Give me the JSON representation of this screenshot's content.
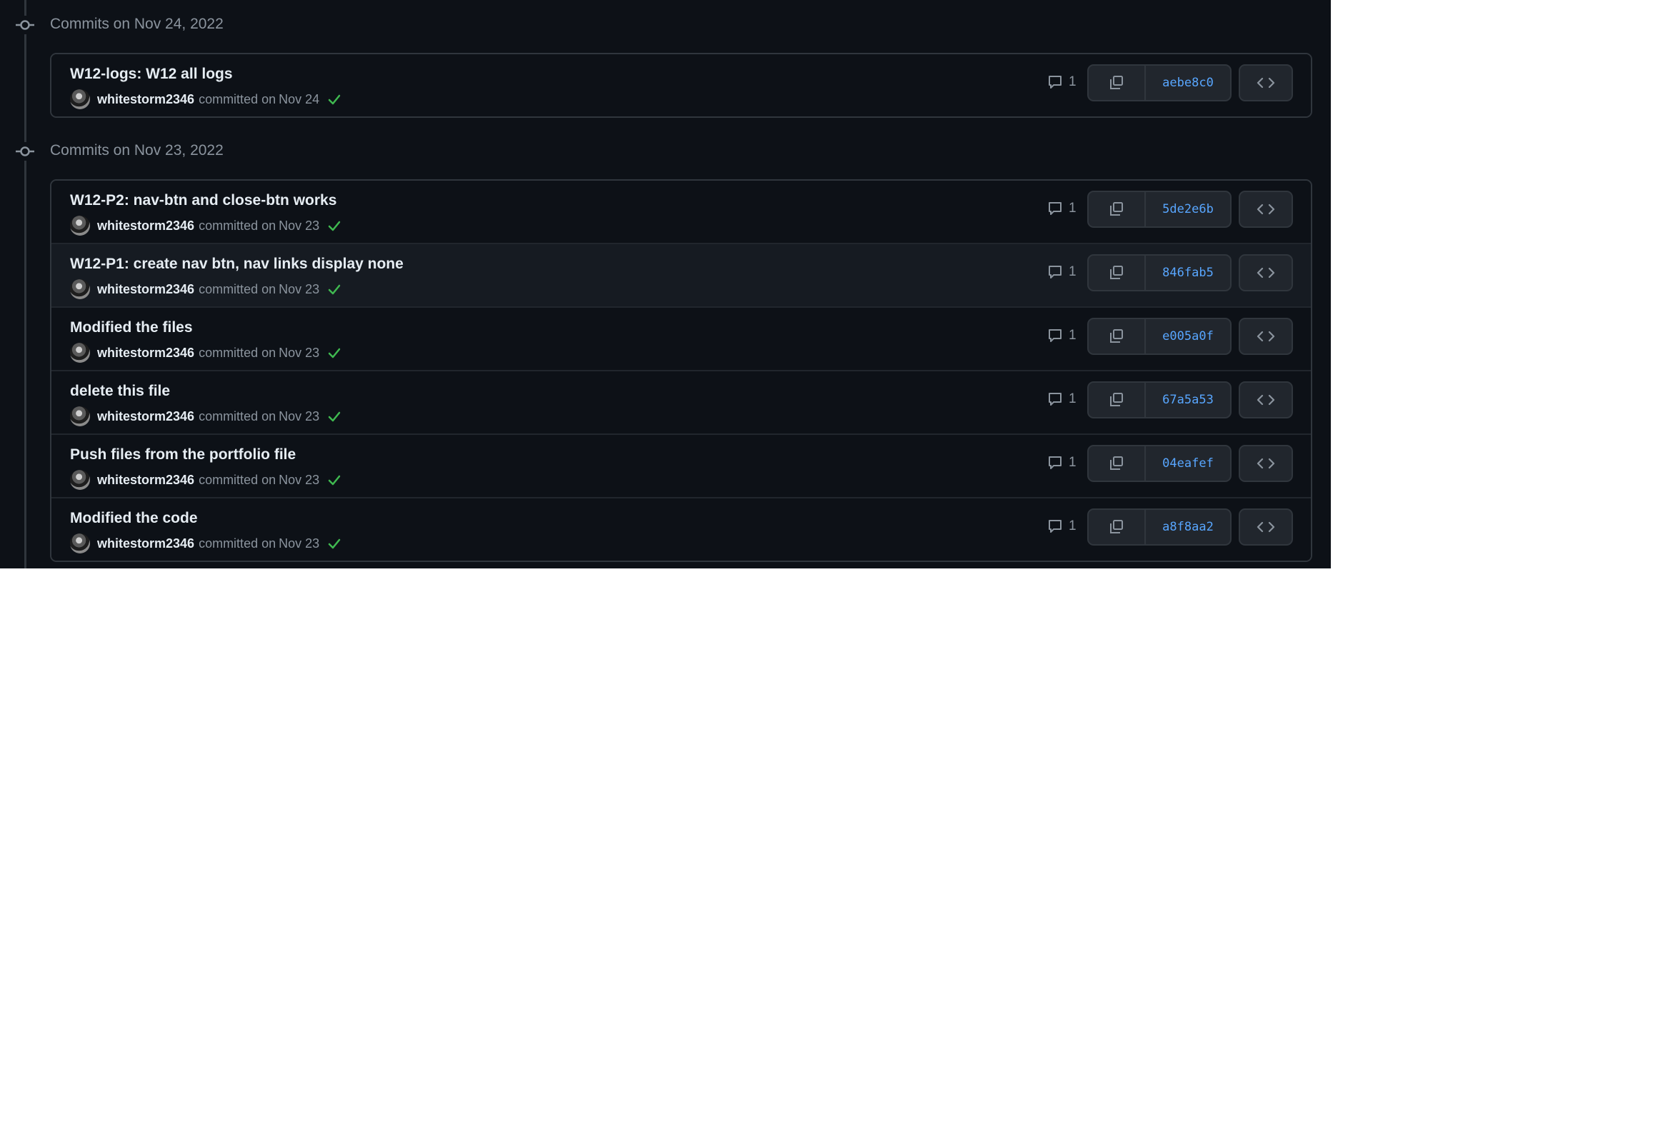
{
  "groups": [
    {
      "title": "Commits on Nov 24, 2022",
      "commits": [
        {
          "message": "W12-logs: W12 all logs",
          "author": "whitestorm2346",
          "committed_text": "committed on",
          "date": "Nov 24",
          "comments": "1",
          "sha": "aebe8c0",
          "status": "success"
        }
      ]
    },
    {
      "title": "Commits on Nov 23, 2022",
      "commits": [
        {
          "message": "W12-P2: nav-btn and close-btn works",
          "author": "whitestorm2346",
          "committed_text": "committed on",
          "date": "Nov 23",
          "comments": "1",
          "sha": "5de2e6b",
          "status": "success"
        },
        {
          "message": "W12-P1: create nav btn, nav links display none",
          "author": "whitestorm2346",
          "committed_text": "committed on",
          "date": "Nov 23",
          "comments": "1",
          "sha": "846fab5",
          "status": "success"
        },
        {
          "message": "Modified the files",
          "author": "whitestorm2346",
          "committed_text": "committed on",
          "date": "Nov 23",
          "comments": "1",
          "sha": "e005a0f",
          "status": "success"
        },
        {
          "message": "delete this file",
          "author": "whitestorm2346",
          "committed_text": "committed on",
          "date": "Nov 23",
          "comments": "1",
          "sha": "67a5a53",
          "status": "success"
        },
        {
          "message": "Push files from the portfolio file",
          "author": "whitestorm2346",
          "committed_text": "committed on",
          "date": "Nov 23",
          "comments": "1",
          "sha": "04eafef",
          "status": "success"
        },
        {
          "message": "Modified the code",
          "author": "whitestorm2346",
          "committed_text": "committed on",
          "date": "Nov 23",
          "comments": "1",
          "sha": "a8f8aa2",
          "status": "success"
        }
      ]
    }
  ],
  "icons": {
    "group": "git-commit-icon",
    "comment": "comment-icon",
    "copy": "copy-icon",
    "browse": "code-icon",
    "status": "check-icon"
  },
  "colors": {
    "background": "#0d1117",
    "border": "#30363d",
    "link": "#58a6ff",
    "success": "#3fb950",
    "muted": "#8b949e"
  }
}
